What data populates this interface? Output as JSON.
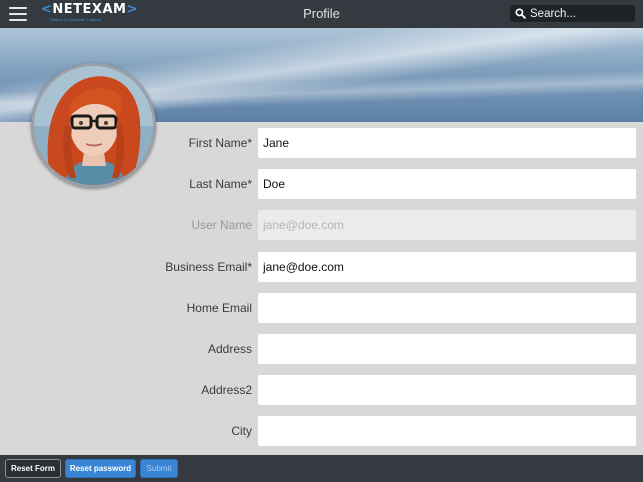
{
  "header": {
    "title": "Profile",
    "logo": {
      "brand": "NETEXAM",
      "tagline": "Partner & Customer Training"
    },
    "search": {
      "placeholder": "Search..."
    },
    "menu_icon": "hamburger-menu-icon",
    "search_icon": "search-icon"
  },
  "profile": {
    "avatar": "profile-photo"
  },
  "form": {
    "fields": [
      {
        "label": "First Name*",
        "value": "Jane",
        "placeholder": "",
        "disabled": false
      },
      {
        "label": "Last Name*",
        "value": "Doe",
        "placeholder": "",
        "disabled": false
      },
      {
        "label": "User Name",
        "value": "",
        "placeholder": "jane@doe.com",
        "disabled": true
      },
      {
        "label": "Business Email*",
        "value": "jane@doe.com",
        "placeholder": "",
        "disabled": false
      },
      {
        "label": "Home Email",
        "value": "",
        "placeholder": "",
        "disabled": false
      },
      {
        "label": "Address",
        "value": "",
        "placeholder": "",
        "disabled": false
      },
      {
        "label": "Address2",
        "value": "",
        "placeholder": "",
        "disabled": false
      },
      {
        "label": "City",
        "value": "",
        "placeholder": "",
        "disabled": false
      }
    ]
  },
  "footer": {
    "reset_form": "Reset Form",
    "reset_password": "Reset password",
    "submit": "Submit"
  },
  "colors": {
    "topbar": "#343a40",
    "accent": "#3a85d6",
    "page_bg": "#d8d8d8"
  }
}
